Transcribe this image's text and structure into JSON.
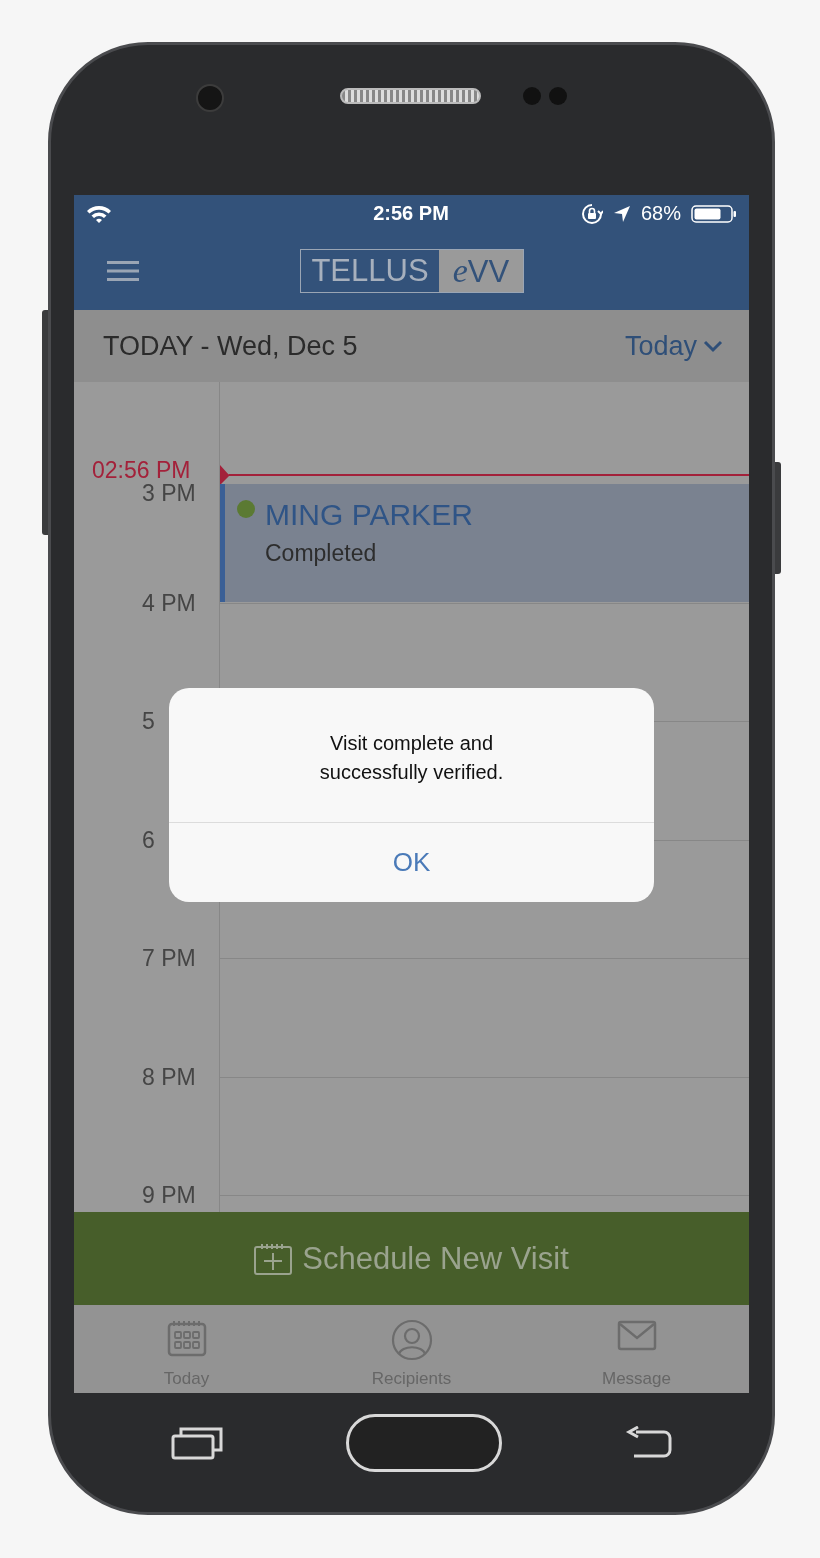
{
  "status_bar": {
    "time": "2:56 PM",
    "battery": "68%"
  },
  "header": {
    "logo_left": "TELLUS",
    "logo_right": "eVV"
  },
  "date_bar": {
    "title": "TODAY - Wed, Dec 5",
    "range": "Today"
  },
  "calendar": {
    "hours": [
      "3 PM",
      "4 PM",
      "5",
      "6",
      "7 PM",
      "8 PM",
      "9 PM"
    ],
    "now": "02:56 PM",
    "events": [
      {
        "name": "MING PARKER",
        "status": "Completed",
        "color": "#5b7a33"
      }
    ]
  },
  "action": {
    "label": "Schedule New Visit"
  },
  "tabs": [
    {
      "kind": "calendar",
      "label": "Today"
    },
    {
      "kind": "person",
      "label": "Recipients"
    },
    {
      "kind": "mail",
      "label": "Message"
    }
  ],
  "dialog": {
    "message": "Visit complete and successfully verified.",
    "button": "OK"
  }
}
